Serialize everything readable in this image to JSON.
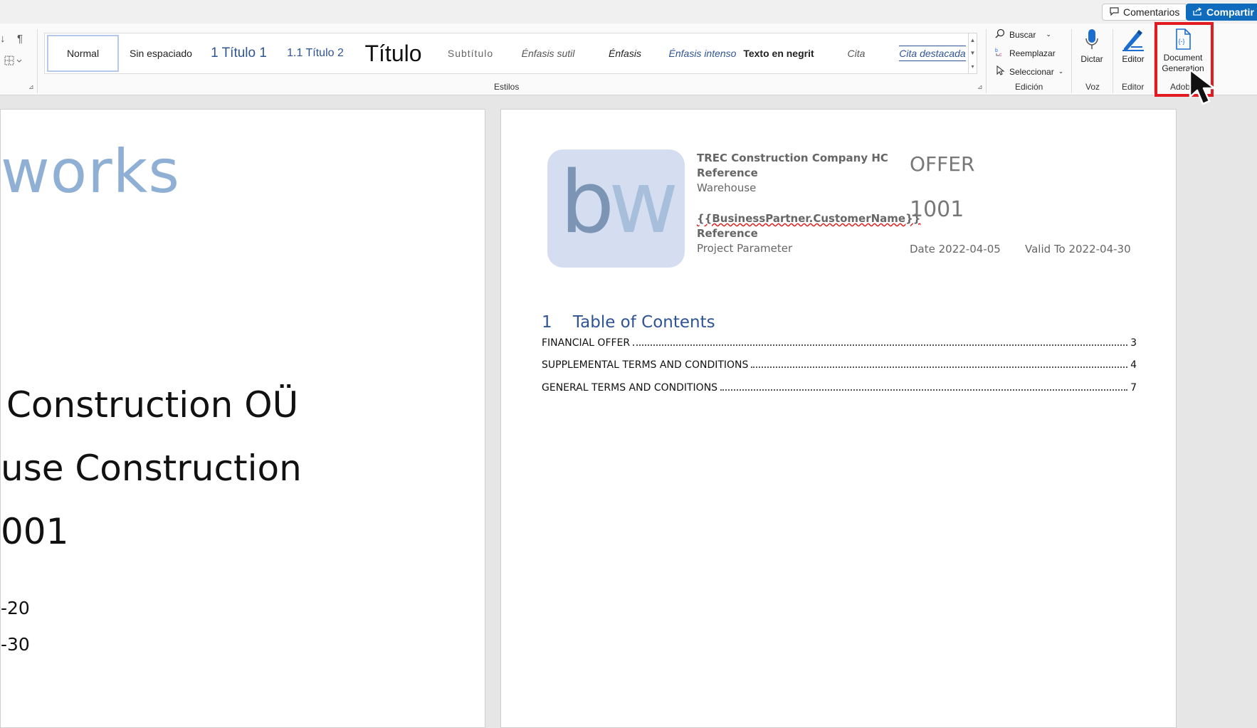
{
  "topbar": {
    "comments_label": "Comentarios",
    "share_label": "Compartir"
  },
  "ribbon": {
    "styles_group_label": "Estilos",
    "styles": [
      "Normal",
      "Sin espaciado",
      "1 Título 1",
      "1.1 Título 2",
      "Título",
      "Subtítulo",
      "Énfasis sutil",
      "Énfasis",
      "Énfasis intenso",
      "Texto en negrit",
      "Cita",
      "Cita destacada"
    ],
    "editing": {
      "group_label": "Edición",
      "find": "Buscar",
      "replace": "Reemplazar",
      "select": "Seleccionar"
    },
    "voice": {
      "group_label": "Voz",
      "dictate": "Dictar"
    },
    "editor": {
      "group_label": "Editor",
      "label": "Editor"
    },
    "adobe": {
      "group_label": "Adobe",
      "doc_gen_line1": "Document",
      "doc_gen_line2": "Generation"
    }
  },
  "left_page": {
    "logo_fragment": "works",
    "line1": "Construction OÜ",
    "line2": "use Construction",
    "line3": "001",
    "line4": "-20",
    "line5": "-30"
  },
  "right_page": {
    "logo_b": "b",
    "logo_w": "w",
    "company": "TREC Construction Company HC",
    "reference1": "Reference",
    "warehouse": "Warehouse",
    "customer_field": "{{BusinessPartner.CustomerName}}",
    "reference2": "Reference",
    "project_param": "Project Parameter",
    "offer_title": "OFFER",
    "offer_number": "1001",
    "date": "Date 2022-04-05",
    "valid_to": "Valid To 2022-04-30",
    "toc_heading": "1    Table of Contents",
    "toc": [
      {
        "title": "FINANCIAL OFFER",
        "page": "3"
      },
      {
        "title": "SUPPLEMENTAL TERMS AND CONDITIONS",
        "page": "4"
      },
      {
        "title": "GENERAL TERMS AND CONDITIONS",
        "page": "7"
      }
    ]
  },
  "colors": {
    "accent": "#0f6cbd",
    "highlight": "#e21a22",
    "logo_bg": "#d5def0",
    "heading_blue": "#2f5496"
  }
}
